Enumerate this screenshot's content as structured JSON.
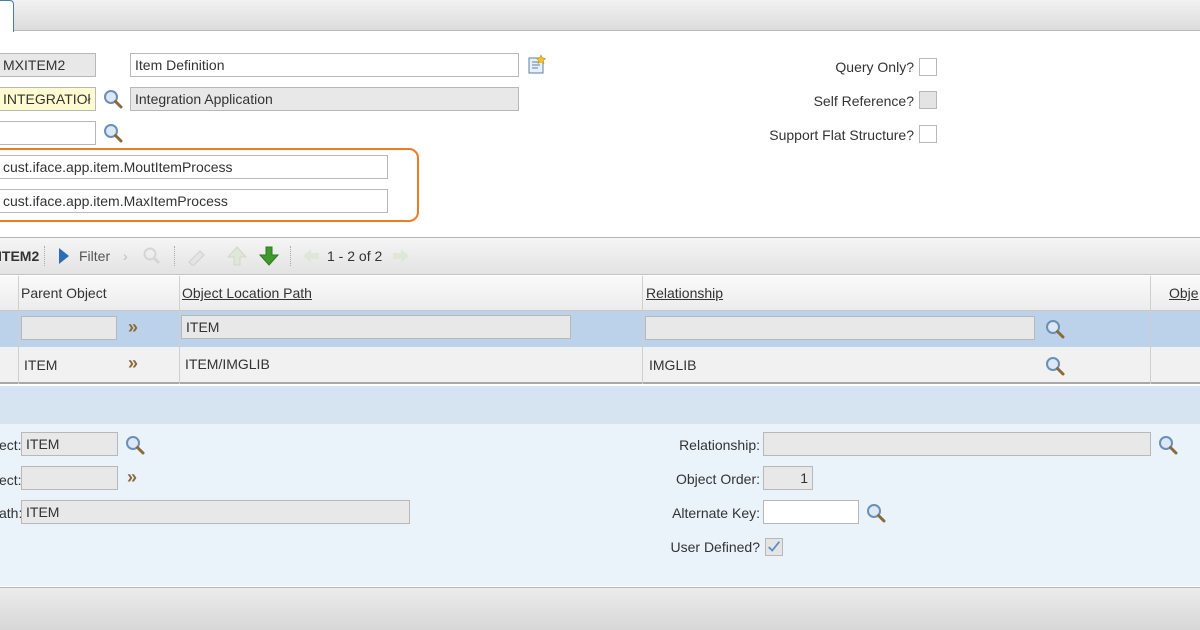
{
  "header": {
    "object_name": "MXITEM2",
    "object_description": "Item Definition",
    "service": "INTEGRATIOł",
    "service_description": "Integration Application",
    "extra_field": "",
    "processing_class_1": "cust.iface.app.item.MoutItemProcess",
    "processing_class_2": "cust.iface.app.item.MaxItemProcess",
    "query_only_label": "Query Only?",
    "self_reference_label": "Self Reference?",
    "support_flat_label": "Support Flat Structure?"
  },
  "table": {
    "title": "ITEM2",
    "filter_label": "Filter",
    "pagination": "1 - 2 of 2",
    "columns": [
      "Parent Object",
      "Object Location Path",
      "Relationship",
      "Obje"
    ],
    "rows": [
      {
        "parent_object": "",
        "location_path": "ITEM",
        "relationship": ""
      },
      {
        "parent_object": "ITEM",
        "location_path": "ITEM/IMGLIB",
        "relationship": "IMGLIB"
      }
    ]
  },
  "detail": {
    "object_label": "ect:",
    "object_value": "ITEM",
    "parent_label": "ect:",
    "parent_value": "",
    "path_label": "ath:",
    "path_value": "ITEM",
    "relationship_label": "Relationship:",
    "relationship_value": "",
    "order_label": "Object Order:",
    "order_value": "1",
    "alt_key_label": "Alternate Key:",
    "alt_key_value": "",
    "user_defined_label": "User Defined?",
    "user_defined": true
  },
  "colors": {
    "highlight_border": "#f07b22",
    "selected_row": "#bcd2ea",
    "detail_bg": "#eaf2fa"
  }
}
